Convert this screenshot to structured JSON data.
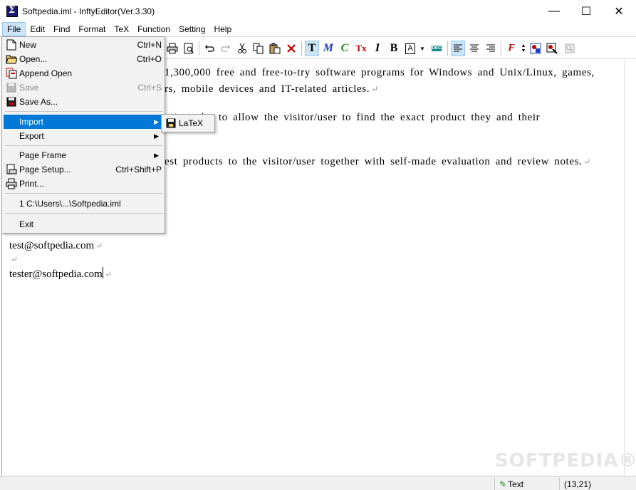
{
  "window": {
    "title": "Softpedia.iml - InftyEditor(Ver.3.30)",
    "controls": {
      "minimize": "—",
      "maximize": "☐",
      "close": "✕"
    }
  },
  "menubar": {
    "items": [
      "File",
      "Edit",
      "Find",
      "Format",
      "TeX",
      "Function",
      "Setting",
      "Help"
    ],
    "active": "File"
  },
  "toolbar": {
    "buttons": [
      "print-icon",
      "print-preview-icon",
      "undo-icon",
      "redo-icon",
      "cut-icon",
      "copy-icon",
      "paste-icon",
      "delete-icon",
      "text-mode-icon",
      "math-mode-icon",
      "chemical-mode-icon",
      "tex-mode-icon",
      "italic-icon",
      "bold-icon",
      "boxed-text-icon",
      "dropdown-icon",
      "dec-icon",
      "align-left-icon",
      "align-center-icon",
      "align-right-icon",
      "font-size-icon",
      "image-icon",
      "image-edit-icon",
      "zoom-icon"
    ],
    "glyphs": {
      "text": "T",
      "math": "M",
      "chem": "C",
      "tex": "Tx",
      "italic": "I",
      "bold": "B",
      "box": "A",
      "dec": "DEC"
    }
  },
  "document": {
    "lines": [
      "1,300,000 free and free-to-try software programs for Windows and Unix/Linux, games,",
      "rs, mobile devices and IT-related articles.",
      "s in order to allow the visitor/user to find the exact product they and their",
      "est products to the visitor/user together with self-made evaluation and review notes.",
      "test@softpedia.com",
      "tester@softpedia.com"
    ],
    "paragraph_mark": "↵"
  },
  "file_menu": {
    "items": [
      {
        "label": "New",
        "shortcut": "Ctrl+N",
        "icon": "new-file-icon"
      },
      {
        "label": "Open...",
        "shortcut": "Ctrl+O",
        "icon": "open-folder-icon"
      },
      {
        "label": "Append Open",
        "shortcut": "",
        "icon": "append-open-icon"
      },
      {
        "label": "Save",
        "shortcut": "Ctrl+S",
        "icon": "save-disk-icon",
        "disabled": true
      },
      {
        "label": "Save As...",
        "shortcut": "",
        "icon": "save-as-icon"
      },
      {
        "label": "Import",
        "shortcut": "",
        "submenu": true,
        "highlighted": true
      },
      {
        "label": "Export",
        "shortcut": "",
        "submenu": true
      },
      {
        "label": "Page Frame",
        "shortcut": "",
        "submenu": true
      },
      {
        "label": "Page Setup...",
        "shortcut": "Ctrl+Shift+P",
        "icon": "page-setup-icon"
      },
      {
        "label": "Print...",
        "shortcut": "",
        "icon": "printer-icon"
      },
      {
        "label": "1 C:\\Users\\...\\Softpedia.iml",
        "shortcut": ""
      },
      {
        "label": "Exit",
        "shortcut": ""
      }
    ]
  },
  "import_submenu": {
    "items": [
      {
        "label": "LaTeX",
        "icon": "floppy-icon"
      }
    ]
  },
  "statusbar": {
    "mode": "Text",
    "position": "(13,21)"
  },
  "watermark": "SOFTPEDIA®",
  "colors": {
    "highlight": "#0078d7",
    "menu_active": "#cce4f7",
    "chem_green": "#1a8a1a",
    "tex_red": "#c00000",
    "math_blue": "#1f3fbf"
  }
}
